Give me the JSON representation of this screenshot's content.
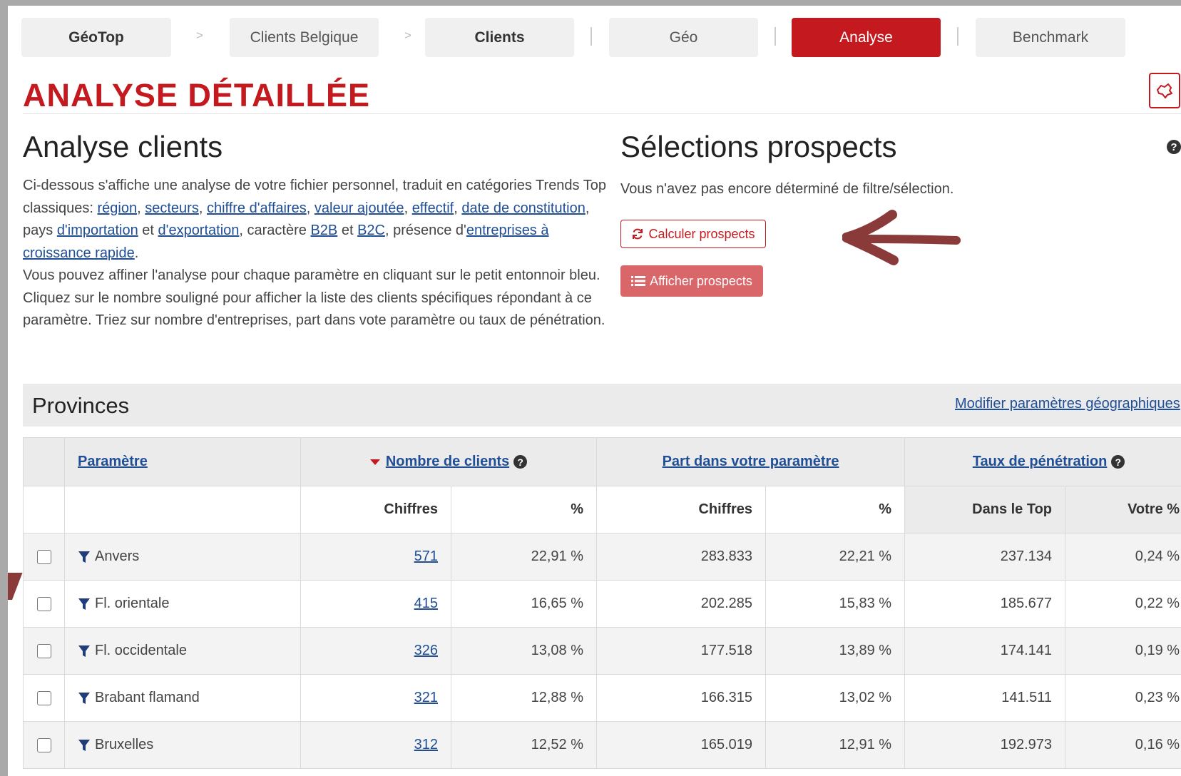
{
  "breadcrumb": {
    "items": [
      {
        "label": "GéoTop"
      },
      {
        "label": "Clients Belgique"
      },
      {
        "label": "Clients"
      },
      {
        "label": "Géo"
      },
      {
        "label": "Analyse"
      },
      {
        "label": "Benchmark"
      }
    ],
    "separator": ">"
  },
  "title": "ANALYSE DÉTAILLÉE",
  "analyse": {
    "heading": "Analyse clients",
    "p1": "Ci-dessous s'affiche une analyse de votre fichier personnel, traduit en catégories Trends Top classiques: ",
    "link_region": "région",
    "link_secteurs": "secteurs",
    "link_ca": "chiffre d'affaires",
    "link_va": "valeur ajoutée",
    "link_effectif": "effectif",
    "link_date": "date de constitution",
    "t_pays": ", pays ",
    "link_import": "d'importation",
    "t_et": " et ",
    "link_export": "d'exportation",
    "t_caractere": ", caractère ",
    "link_b2b": "B2B",
    "link_b2c": "B2C",
    "t_presence": "présence d'",
    "link_croissance": "entreprises à croissance rapide",
    "p2": "Vous pouvez affiner l'analyse pour chaque paramètre en cliquant sur le petit entonnoir bleu. Cliquez sur le nombre souligné pour afficher la liste des clients spécifiques répondant à ce paramètre. Triez sur nombre d'entreprises, part dans vote paramètre ou taux de pénétration."
  },
  "prospects": {
    "heading": "Sélections prospects",
    "status": "Vous n'avez pas encore déterminé de filtre/sélection.",
    "calc_button": "Calculer prospects",
    "show_button": "Afficher prospects"
  },
  "provinces": {
    "title": "Provinces",
    "modify_link": "Modifier paramètres géographiques",
    "headers": {
      "parametre": "Paramètre",
      "nombre": "Nombre de clients",
      "part": "Part dans votre paramètre",
      "taux": "Taux de pénétration",
      "chiffres": "Chiffres",
      "pct": "%",
      "dans_top": "Dans le Top",
      "votre_pct": "Votre %"
    },
    "rows": [
      {
        "name": "Anvers",
        "clients": "571",
        "clients_pct": "22,91 %",
        "part": "283.833",
        "part_pct": "22,21 %",
        "top": "237.134",
        "votre": "0,24 %"
      },
      {
        "name": "Fl. orientale",
        "clients": "415",
        "clients_pct": "16,65 %",
        "part": "202.285",
        "part_pct": "15,83 %",
        "top": "185.677",
        "votre": "0,22 %"
      },
      {
        "name": "Fl. occidentale",
        "clients": "326",
        "clients_pct": "13,08 %",
        "part": "177.518",
        "part_pct": "13,89 %",
        "top": "174.141",
        "votre": "0,19 %"
      },
      {
        "name": "Brabant flamand",
        "clients": "321",
        "clients_pct": "12,88 %",
        "part": "166.315",
        "part_pct": "13,02 %",
        "top": "141.511",
        "votre": "0,23 %"
      },
      {
        "name": "Bruxelles",
        "clients": "312",
        "clients_pct": "12,52 %",
        "part": "165.019",
        "part_pct": "12,91 %",
        "top": "192.973",
        "votre": "0,16 %"
      }
    ]
  },
  "colors": {
    "brand_red": "#c41a1f",
    "link_blue": "#1f4e96",
    "annotation_arrow": "#8b3a3a"
  }
}
